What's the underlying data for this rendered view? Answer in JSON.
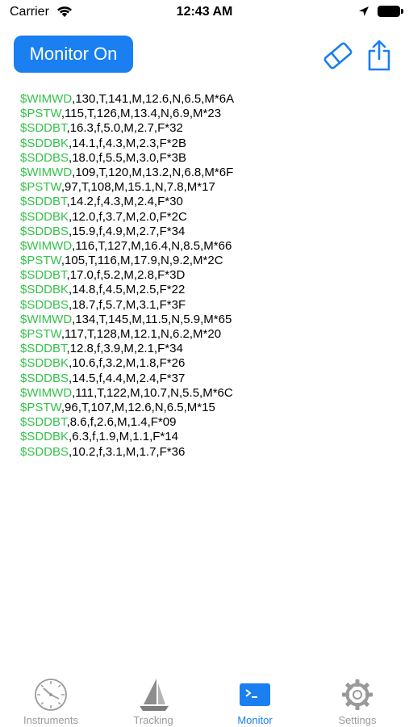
{
  "status_bar": {
    "carrier": "Carrier",
    "time": "12:43 AM"
  },
  "toolbar": {
    "monitor_label": "Monitor On"
  },
  "log_lines": [
    {
      "tag": "$WIMWD",
      "data": ",130,T,141,M,12.6,N,6.5,M*6A"
    },
    {
      "tag": "$PSTW",
      "data": ",115,T,126,M,13.4,N,6.9,M*23"
    },
    {
      "tag": "$SDDBT",
      "data": ",16.3,f,5.0,M,2.7,F*32"
    },
    {
      "tag": "$SDDBK",
      "data": ",14.1,f,4.3,M,2.3,F*2B"
    },
    {
      "tag": "$SDDBS",
      "data": ",18.0,f,5.5,M,3.0,F*3B"
    },
    {
      "tag": "$WIMWD",
      "data": ",109,T,120,M,13.2,N,6.8,M*6F"
    },
    {
      "tag": "$PSTW",
      "data": ",97,T,108,M,15.1,N,7.8,M*17"
    },
    {
      "tag": "$SDDBT",
      "data": ",14.2,f,4.3,M,2.4,F*30"
    },
    {
      "tag": "$SDDBK",
      "data": ",12.0,f,3.7,M,2.0,F*2C"
    },
    {
      "tag": "$SDDBS",
      "data": ",15.9,f,4.9,M,2.7,F*34"
    },
    {
      "tag": "$WIMWD",
      "data": ",116,T,127,M,16.4,N,8.5,M*66"
    },
    {
      "tag": "$PSTW",
      "data": ",105,T,116,M,17.9,N,9.2,M*2C"
    },
    {
      "tag": "$SDDBT",
      "data": ",17.0,f,5.2,M,2.8,F*3D"
    },
    {
      "tag": "$SDDBK",
      "data": ",14.8,f,4.5,M,2.5,F*22"
    },
    {
      "tag": "$SDDBS",
      "data": ",18.7,f,5.7,M,3.1,F*3F"
    },
    {
      "tag": "$WIMWD",
      "data": ",134,T,145,M,11.5,N,5.9,M*65"
    },
    {
      "tag": "$PSTW",
      "data": ",117,T,128,M,12.1,N,6.2,M*20"
    },
    {
      "tag": "$SDDBT",
      "data": ",12.8,f,3.9,M,2.1,F*34"
    },
    {
      "tag": "$SDDBK",
      "data": ",10.6,f,3.2,M,1.8,F*26"
    },
    {
      "tag": "$SDDBS",
      "data": ",14.5,f,4.4,M,2.4,F*37"
    },
    {
      "tag": "$WIMWD",
      "data": ",111,T,122,M,10.7,N,5.5,M*6C"
    },
    {
      "tag": "$PSTW",
      "data": ",96,T,107,M,12.6,N,6.5,M*15"
    },
    {
      "tag": "$SDDBT",
      "data": ",8.6,f,2.6,M,1.4,F*09"
    },
    {
      "tag": "$SDDBK",
      "data": ",6.3,f,1.9,M,1.1,F*14"
    },
    {
      "tag": "$SDDBS",
      "data": ",10.2,f,3.1,M,1.7,F*36"
    }
  ],
  "tabs": [
    {
      "label": "Instruments",
      "icon": "gauge-icon"
    },
    {
      "label": "Tracking",
      "icon": "sailboat-icon"
    },
    {
      "label": "Monitor",
      "icon": "terminal-icon",
      "active": true
    },
    {
      "label": "Settings",
      "icon": "gear-icon"
    }
  ],
  "colors": {
    "accent": "#1a7ff0",
    "sentence_tag": "#34c24a",
    "inactive_tab": "#9a9a9a"
  }
}
